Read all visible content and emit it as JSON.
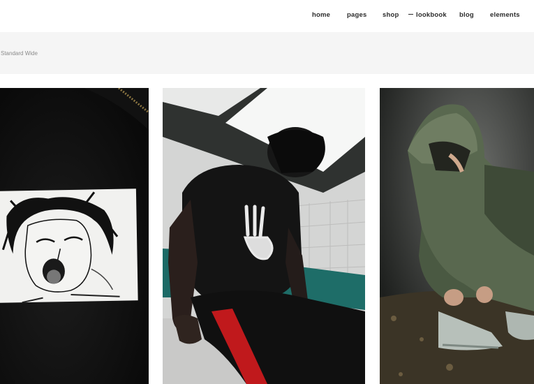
{
  "header": {
    "nav": [
      {
        "label": "home"
      },
      {
        "label": "pages"
      },
      {
        "label": "shop"
      },
      {
        "label": "lookbook",
        "active": true
      },
      {
        "label": "blog"
      },
      {
        "label": "elements"
      }
    ]
  },
  "page": {
    "subtitle": "Standard Wide"
  },
  "gallery": {
    "items": [
      {
        "image": "black-jacket-anime-patch-photo"
      },
      {
        "image": "man-black-tshirt-skeleton-hand-photo"
      },
      {
        "image": "green-hooded-jacket-tying-shoes-photo"
      }
    ]
  },
  "colors": {
    "nav_text": "#2b2b2b",
    "band_background": "#f5f5f5",
    "subtitle_text": "#8a8a8a"
  }
}
